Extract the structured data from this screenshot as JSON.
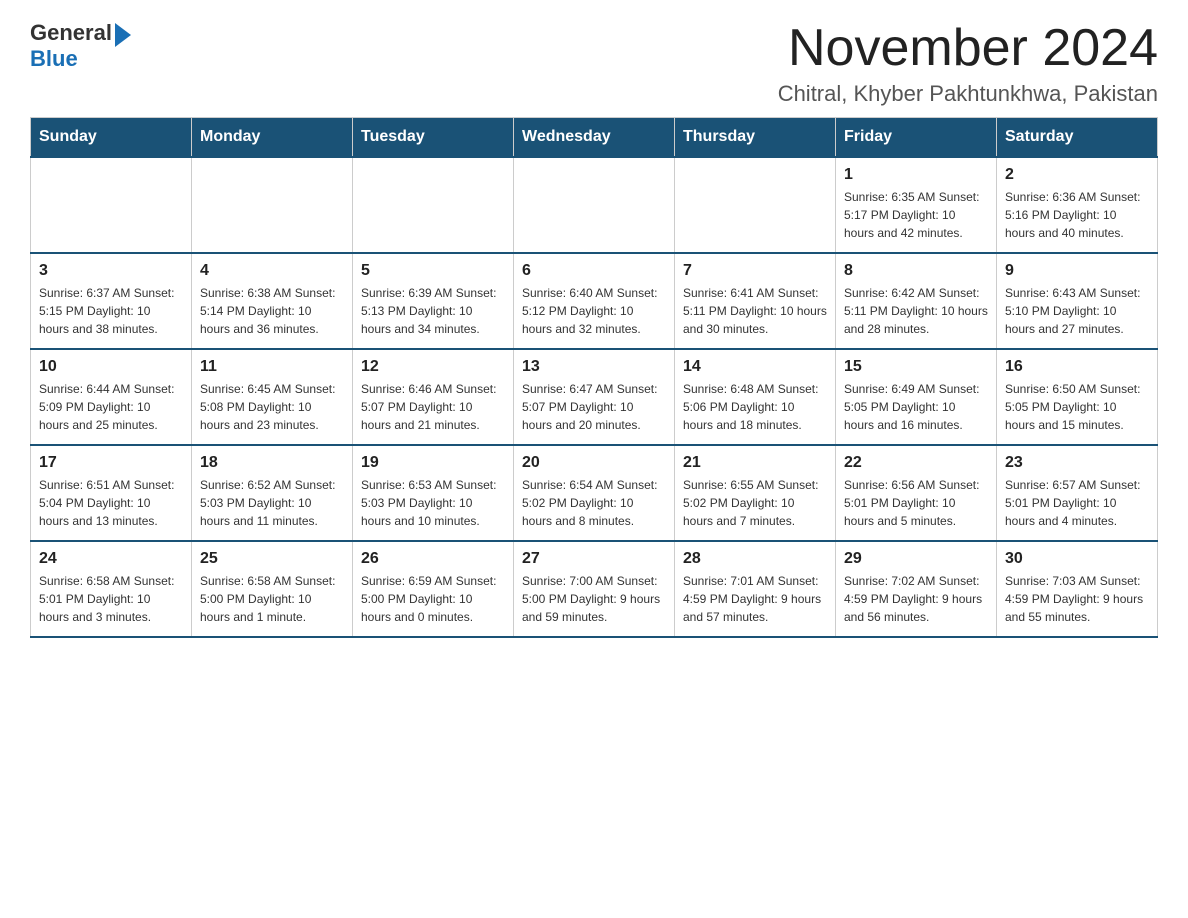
{
  "logo": {
    "general": "General",
    "blue": "Blue"
  },
  "header": {
    "month_title": "November 2024",
    "location": "Chitral, Khyber Pakhtunkhwa, Pakistan"
  },
  "columns": [
    "Sunday",
    "Monday",
    "Tuesday",
    "Wednesday",
    "Thursday",
    "Friday",
    "Saturday"
  ],
  "weeks": [
    [
      {
        "day": "",
        "info": ""
      },
      {
        "day": "",
        "info": ""
      },
      {
        "day": "",
        "info": ""
      },
      {
        "day": "",
        "info": ""
      },
      {
        "day": "",
        "info": ""
      },
      {
        "day": "1",
        "info": "Sunrise: 6:35 AM\nSunset: 5:17 PM\nDaylight: 10 hours\nand 42 minutes."
      },
      {
        "day": "2",
        "info": "Sunrise: 6:36 AM\nSunset: 5:16 PM\nDaylight: 10 hours\nand 40 minutes."
      }
    ],
    [
      {
        "day": "3",
        "info": "Sunrise: 6:37 AM\nSunset: 5:15 PM\nDaylight: 10 hours\nand 38 minutes."
      },
      {
        "day": "4",
        "info": "Sunrise: 6:38 AM\nSunset: 5:14 PM\nDaylight: 10 hours\nand 36 minutes."
      },
      {
        "day": "5",
        "info": "Sunrise: 6:39 AM\nSunset: 5:13 PM\nDaylight: 10 hours\nand 34 minutes."
      },
      {
        "day": "6",
        "info": "Sunrise: 6:40 AM\nSunset: 5:12 PM\nDaylight: 10 hours\nand 32 minutes."
      },
      {
        "day": "7",
        "info": "Sunrise: 6:41 AM\nSunset: 5:11 PM\nDaylight: 10 hours\nand 30 minutes."
      },
      {
        "day": "8",
        "info": "Sunrise: 6:42 AM\nSunset: 5:11 PM\nDaylight: 10 hours\nand 28 minutes."
      },
      {
        "day": "9",
        "info": "Sunrise: 6:43 AM\nSunset: 5:10 PM\nDaylight: 10 hours\nand 27 minutes."
      }
    ],
    [
      {
        "day": "10",
        "info": "Sunrise: 6:44 AM\nSunset: 5:09 PM\nDaylight: 10 hours\nand 25 minutes."
      },
      {
        "day": "11",
        "info": "Sunrise: 6:45 AM\nSunset: 5:08 PM\nDaylight: 10 hours\nand 23 minutes."
      },
      {
        "day": "12",
        "info": "Sunrise: 6:46 AM\nSunset: 5:07 PM\nDaylight: 10 hours\nand 21 minutes."
      },
      {
        "day": "13",
        "info": "Sunrise: 6:47 AM\nSunset: 5:07 PM\nDaylight: 10 hours\nand 20 minutes."
      },
      {
        "day": "14",
        "info": "Sunrise: 6:48 AM\nSunset: 5:06 PM\nDaylight: 10 hours\nand 18 minutes."
      },
      {
        "day": "15",
        "info": "Sunrise: 6:49 AM\nSunset: 5:05 PM\nDaylight: 10 hours\nand 16 minutes."
      },
      {
        "day": "16",
        "info": "Sunrise: 6:50 AM\nSunset: 5:05 PM\nDaylight: 10 hours\nand 15 minutes."
      }
    ],
    [
      {
        "day": "17",
        "info": "Sunrise: 6:51 AM\nSunset: 5:04 PM\nDaylight: 10 hours\nand 13 minutes."
      },
      {
        "day": "18",
        "info": "Sunrise: 6:52 AM\nSunset: 5:03 PM\nDaylight: 10 hours\nand 11 minutes."
      },
      {
        "day": "19",
        "info": "Sunrise: 6:53 AM\nSunset: 5:03 PM\nDaylight: 10 hours\nand 10 minutes."
      },
      {
        "day": "20",
        "info": "Sunrise: 6:54 AM\nSunset: 5:02 PM\nDaylight: 10 hours\nand 8 minutes."
      },
      {
        "day": "21",
        "info": "Sunrise: 6:55 AM\nSunset: 5:02 PM\nDaylight: 10 hours\nand 7 minutes."
      },
      {
        "day": "22",
        "info": "Sunrise: 6:56 AM\nSunset: 5:01 PM\nDaylight: 10 hours\nand 5 minutes."
      },
      {
        "day": "23",
        "info": "Sunrise: 6:57 AM\nSunset: 5:01 PM\nDaylight: 10 hours\nand 4 minutes."
      }
    ],
    [
      {
        "day": "24",
        "info": "Sunrise: 6:58 AM\nSunset: 5:01 PM\nDaylight: 10 hours\nand 3 minutes."
      },
      {
        "day": "25",
        "info": "Sunrise: 6:58 AM\nSunset: 5:00 PM\nDaylight: 10 hours\nand 1 minute."
      },
      {
        "day": "26",
        "info": "Sunrise: 6:59 AM\nSunset: 5:00 PM\nDaylight: 10 hours\nand 0 minutes."
      },
      {
        "day": "27",
        "info": "Sunrise: 7:00 AM\nSunset: 5:00 PM\nDaylight: 9 hours\nand 59 minutes."
      },
      {
        "day": "28",
        "info": "Sunrise: 7:01 AM\nSunset: 4:59 PM\nDaylight: 9 hours\nand 57 minutes."
      },
      {
        "day": "29",
        "info": "Sunrise: 7:02 AM\nSunset: 4:59 PM\nDaylight: 9 hours\nand 56 minutes."
      },
      {
        "day": "30",
        "info": "Sunrise: 7:03 AM\nSunset: 4:59 PM\nDaylight: 9 hours\nand 55 minutes."
      }
    ]
  ]
}
